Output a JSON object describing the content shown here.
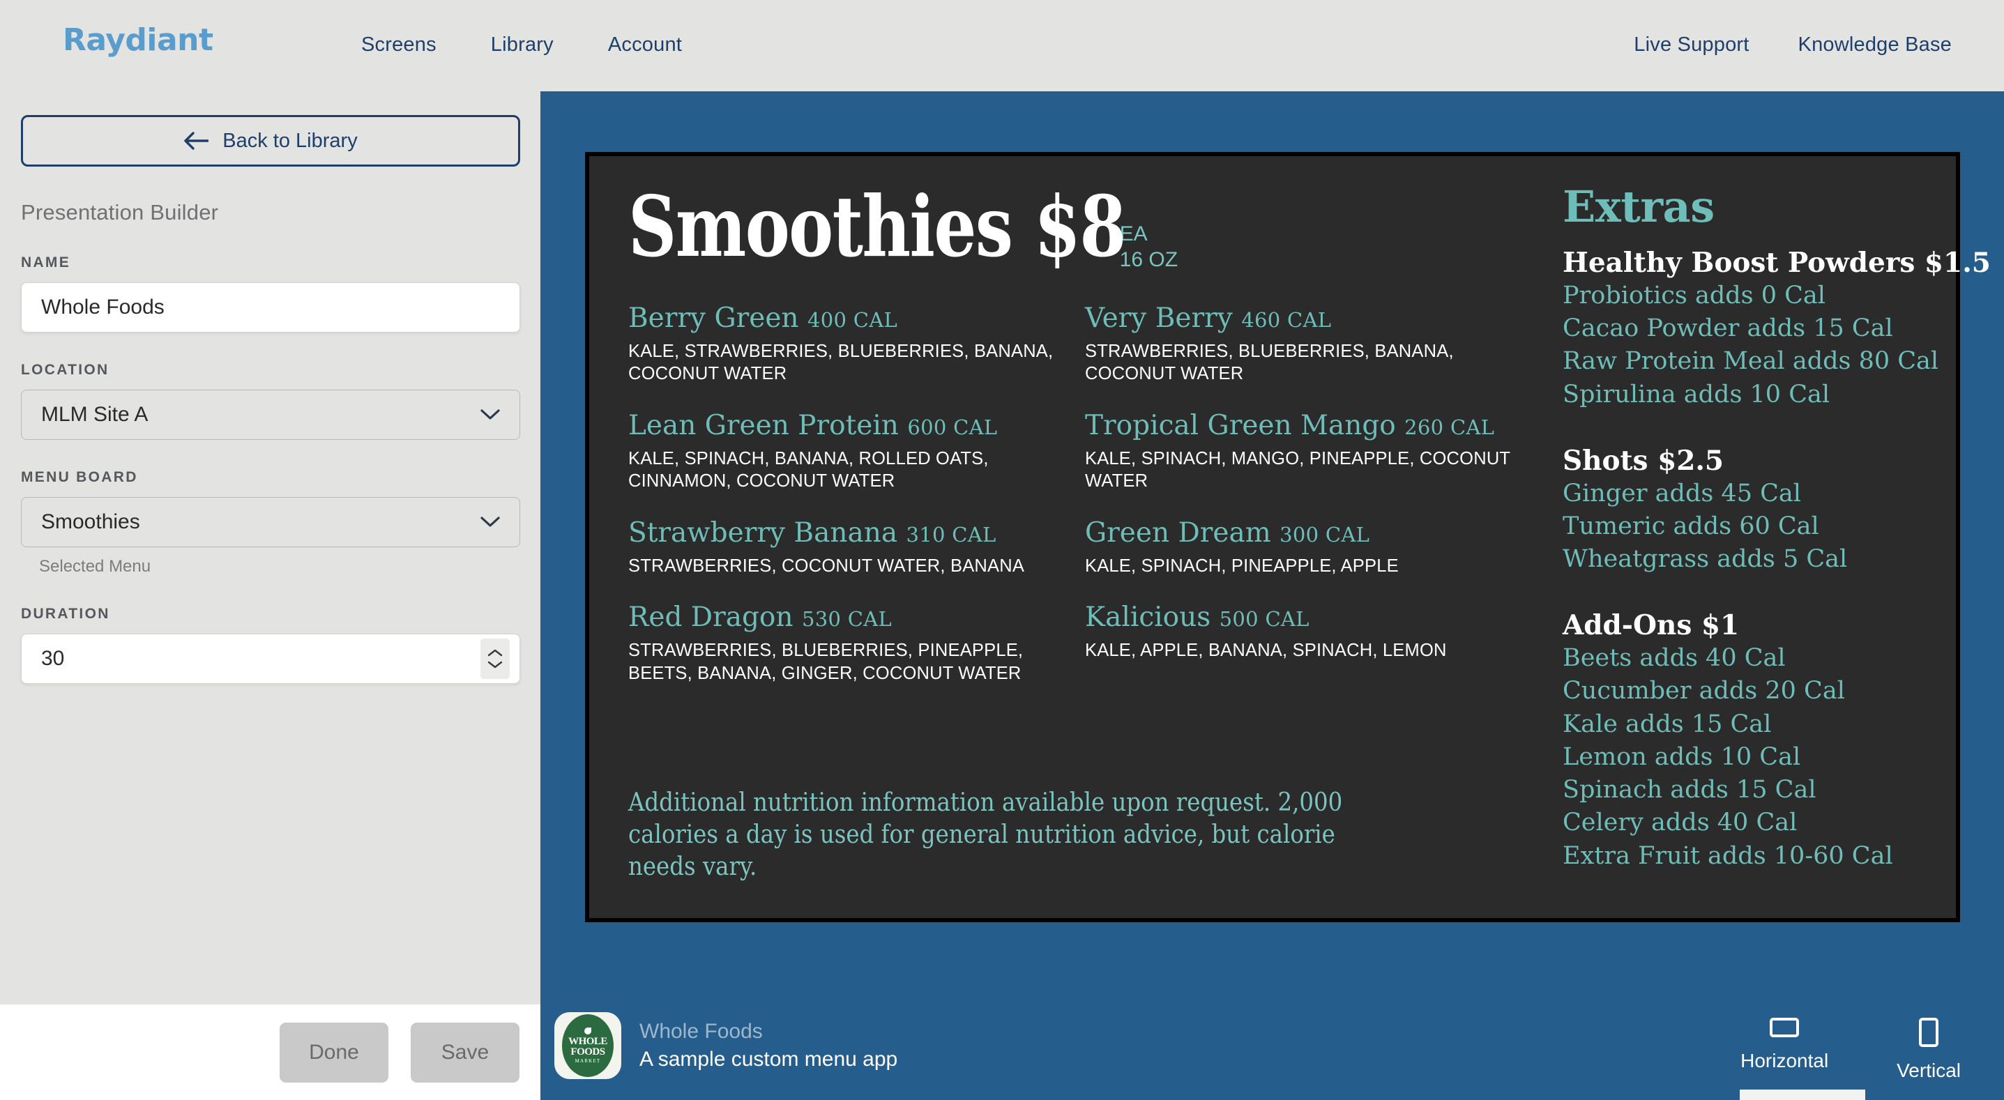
{
  "header": {
    "brand": "Raydiant",
    "nav_center": [
      {
        "label": "Screens"
      },
      {
        "label": "Library"
      },
      {
        "label": "Account"
      }
    ],
    "nav_right": [
      {
        "label": "Live Support"
      },
      {
        "label": "Knowledge Base"
      }
    ]
  },
  "sidebar": {
    "back_label": "Back to Library",
    "builder_title": "Presentation Builder",
    "fields": {
      "name": {
        "label": "NAME",
        "value": "Whole Foods"
      },
      "location": {
        "label": "LOCATION",
        "value": "MLM Site A"
      },
      "menu_board": {
        "label": "MENU BOARD",
        "value": "Smoothies",
        "helper": "Selected Menu"
      },
      "duration": {
        "label": "DURATION",
        "value": "30"
      }
    },
    "footer": {
      "done_label": "Done",
      "save_label": "Save"
    }
  },
  "preview": {
    "accent_blue": "#255d8c",
    "board": {
      "background": "#2b2b2b",
      "teal": "#6ebdb8",
      "title": "Smoothies $8",
      "title_meta_line1": "EA",
      "title_meta_line2": "16 OZ",
      "columns": [
        {
          "items": [
            {
              "name": "Berry Green",
              "calories": "400 CAL",
              "ingredients": "KALE, STRAWBERRIES, BLUEBERRIES, BANANA, COCONUT WATER"
            },
            {
              "name": "Lean Green Protein",
              "calories": "600 CAL",
              "ingredients": "KALE, SPINACH, BANANA, ROLLED OATS, CINNAMON, COCONUT WATER"
            },
            {
              "name": "Strawberry Banana",
              "calories": "310 CAL",
              "ingredients": "STRAWBERRIES, COCONUT WATER, BANANA"
            },
            {
              "name": "Red Dragon",
              "calories": "530 CAL",
              "ingredients": "STRAWBERRIES, BLUEBERRIES, PINEAPPLE, BEETS, BANANA, GINGER, COCONUT WATER"
            }
          ]
        },
        {
          "items": [
            {
              "name": "Very Berry",
              "calories": "460 CAL",
              "ingredients": "STRAWBERRIES, BLUEBERRIES, BANANA, COCONUT WATER"
            },
            {
              "name": "Tropical Green Mango",
              "calories": "260 CAL",
              "ingredients": "KALE, SPINACH, MANGO, PINEAPPLE, COCONUT WATER"
            },
            {
              "name": "Green Dream",
              "calories": "300 CAL",
              "ingredients": "KALE, SPINACH, PINEAPPLE, APPLE"
            },
            {
              "name": "Kalicious",
              "calories": "500 CAL",
              "ingredients": "KALE, APPLE, BANANA, SPINACH, LEMON"
            }
          ]
        }
      ],
      "extras": {
        "title": "Extras",
        "groups": [
          {
            "heading": "Healthy Boost Powders $1.5",
            "lines": [
              "Probiotics adds 0 Cal",
              "Cacao Powder adds 15 Cal",
              "Raw Protein Meal adds 80 Cal",
              "Spirulina adds 10 Cal"
            ]
          },
          {
            "heading": "Shots $2.5",
            "lines": [
              "Ginger adds 45 Cal",
              "Tumeric adds 60 Cal",
              "Wheatgrass adds 5 Cal"
            ]
          },
          {
            "heading": "Add-Ons $1",
            "lines": [
              "Beets adds 40 Cal",
              "Cucumber adds 20 Cal",
              "Kale adds 15 Cal",
              "Lemon adds 10 Cal",
              "Spinach adds 15 Cal",
              "Celery adds 40 Cal",
              "Extra Fruit adds 10-60 Cal"
            ]
          }
        ]
      },
      "disclaimer": "Additional nutrition information available upon request. 2,000 calories a day is used for general nutrition advice, but calorie needs vary."
    },
    "app_meta": {
      "logo_line1": "WHOLE",
      "logo_line2": "FOODS",
      "logo_line3": "MARKET",
      "name": "Whole Foods",
      "description": "A sample custom menu app"
    },
    "orientation": {
      "horizontal_label": "Horizontal",
      "vertical_label": "Vertical",
      "selected": "Horizontal"
    }
  }
}
